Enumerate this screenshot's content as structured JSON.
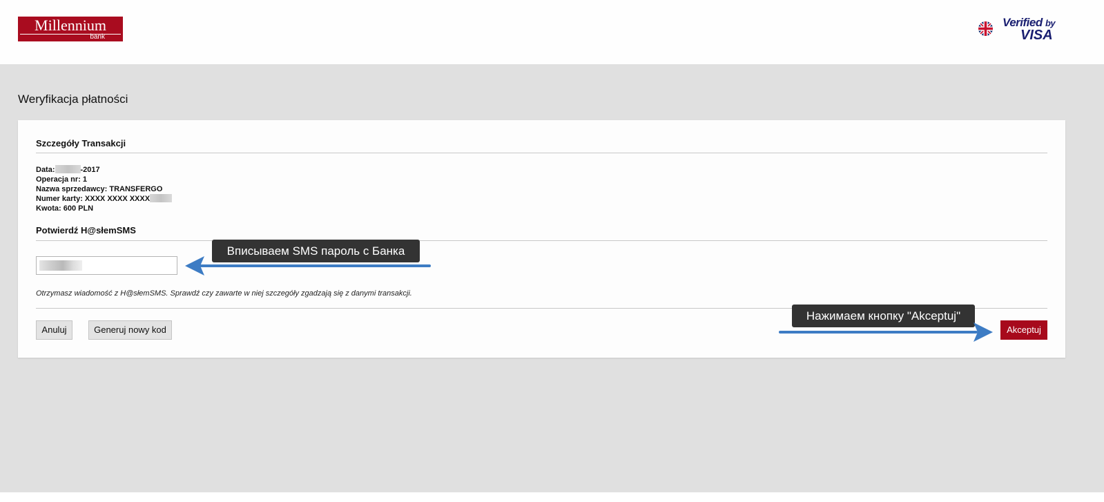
{
  "header": {
    "logo_name": "Millennium",
    "logo_sub": "bank",
    "language_icon": "uk-flag-icon",
    "badge_line1": "Verified",
    "badge_by": "by",
    "badge_line2": "VISA"
  },
  "page_title": "Weryfikacja płatności",
  "transaction": {
    "section_title": "Szczegóły Transakcji",
    "date_label": "Data:",
    "date_suffix": "-2017",
    "operation": "Operacja nr: 1",
    "merchant": "Nazwa sprzedawcy: TRANSFERGO",
    "card_label": "Numer karty: XXXX XXXX XXXX",
    "amount": "Kwota: 600 PLN"
  },
  "confirm": {
    "section_title": "Potwierdź H@słemSMS",
    "hint": "Otrzymasz wiadomość z H@słemSMS. Sprawdź czy zawarte w niej szczegóły zgadzają się z danymi transakcji."
  },
  "buttons": {
    "cancel": "Anuluj",
    "new_code": "Generuj nowy kod",
    "accept": "Akceptuj"
  },
  "annotations": {
    "callout_sms": "Вписываем SMS пароль с Банка",
    "callout_accept": "Нажимаем кнопку \"Akceptuj\""
  },
  "colors": {
    "brand_red": "#a90c1f",
    "accept_red": "#a70a1c",
    "arrow_blue": "#3d7cc4",
    "callout_bg": "#333333",
    "page_gray": "#e0e0e0"
  }
}
